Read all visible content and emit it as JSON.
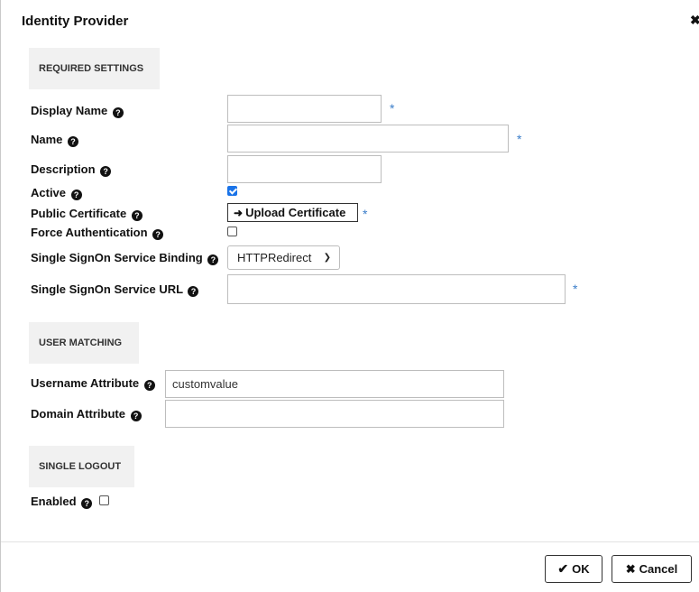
{
  "dialog": {
    "title": "Identity Provider",
    "close_glyph": "✖"
  },
  "sections": {
    "required": "REQUIRED SETTINGS",
    "user_matching": "USER MATCHING",
    "single_logout": "SINGLE LOGOUT"
  },
  "fields": {
    "display_name": {
      "label": "Display Name",
      "value": ""
    },
    "name": {
      "label": "Name",
      "value": ""
    },
    "description": {
      "label": "Description",
      "value": ""
    },
    "active": {
      "label": "Active",
      "checked": true
    },
    "public_certificate": {
      "label": "Public Certificate",
      "button": "Upload Certificate"
    },
    "force_authentication": {
      "label": "Force Authentication",
      "checked": false
    },
    "sso_binding": {
      "label": "Single SignOn Service Binding",
      "value": "HTTPRedirect"
    },
    "sso_url": {
      "label": "Single SignOn Service URL",
      "value": ""
    },
    "username_attribute": {
      "label": "Username Attribute",
      "value": "customvalue"
    },
    "domain_attribute": {
      "label": "Domain Attribute",
      "value": ""
    },
    "slo_enabled": {
      "label": "Enabled",
      "checked": false
    }
  },
  "required_marker": "*",
  "help_glyph": "?",
  "buttons": {
    "ok": "OK",
    "cancel": "Cancel"
  },
  "icons": {
    "help": "question-circle-icon",
    "upload": "sign-in-icon",
    "ok": "check-icon",
    "cancel": "times-icon",
    "close": "close-icon"
  }
}
